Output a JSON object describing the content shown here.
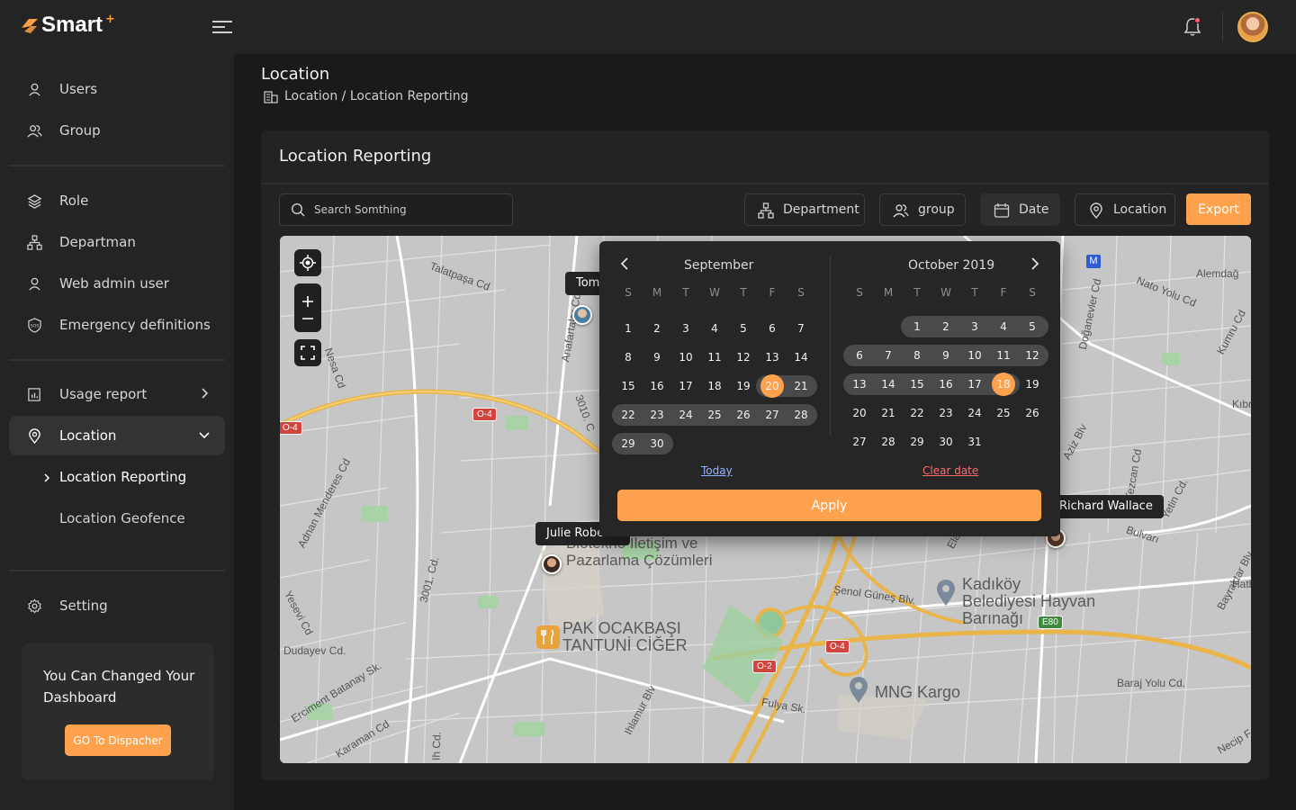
{
  "brand": {
    "name": "Smart",
    "sup": "+",
    "accent": "#ffa24d"
  },
  "sidebar": {
    "items": [
      {
        "label": "Users",
        "icon": "user-icon"
      },
      {
        "label": "Group",
        "icon": "users-icon"
      },
      {
        "label": "Role",
        "icon": "layers-icon"
      },
      {
        "label": "Departman",
        "icon": "org-chart-icon"
      },
      {
        "label": "Web admin user",
        "icon": "user-icon"
      },
      {
        "label": "Emergency definitions",
        "icon": "sos-shield-icon"
      },
      {
        "label": "Usage report",
        "icon": "report-icon"
      },
      {
        "label": "Location",
        "icon": "location-pin-icon"
      },
      {
        "label": "Setting",
        "icon": "gear-icon"
      }
    ],
    "location_sub": [
      {
        "label": "Location Reporting"
      },
      {
        "label": "Location Geofence"
      }
    ],
    "promo": {
      "text": "You Can Changed Your Dashboard",
      "button": "GO To Dispacher"
    }
  },
  "header": {
    "title": "Location",
    "breadcrumb": "Location / Location Reporting"
  },
  "card": {
    "title": "Location Reporting",
    "search_placeholder": "Search Somthing",
    "filters": {
      "department": "Department",
      "group": "group",
      "date": "Date",
      "location": "Location"
    },
    "export": "Export"
  },
  "map": {
    "users": [
      "Tom",
      "Julie Roberts",
      "Richard Wallace"
    ],
    "poi": [
      "Biotekno İletişim ve Pazarlama Çözümleri",
      "PAK OCAKBAŞI TANTUNİ CİĞER",
      "Kadıköy Belediyesi Hayvan Barınağı",
      "MNG Kargo"
    ],
    "streets": [
      "Talatpaşa Cd",
      "Anafartalar Cd",
      "Nato Yolu Cd",
      "Alemdağ",
      "Kumru Cd",
      "Doğanevler Cd",
      "Adnan Menderes Cd",
      "3001. Cd.",
      "Şenol Güneş Blv.",
      "Fulya Sk.",
      "Ihlamur Blv",
      "Erciment Batanay Sk.",
      "Karaman Cd",
      "Dudayev Cd.",
      "Yesevi Cd",
      "Baraj Yolu Cd.",
      "Bayraktar Blv.",
      "Necip F",
      "Aziz Blv",
      "Tezcan Cd",
      "Yetin Cd.",
      "Bulvarı",
      "3010. C",
      "Ela",
      "Kıbr",
      "Hatb",
      "Ih Cd.",
      "Nesa Cd"
    ],
    "roads": [
      "O-4",
      "O-4",
      "O-4",
      "O-2",
      "E80"
    ],
    "metro": "M"
  },
  "datepicker": {
    "months": [
      {
        "name": "September",
        "lead": 0,
        "days": 30
      },
      {
        "name": "October 2019",
        "lead": 2,
        "days": 31
      }
    ],
    "dow": [
      "S",
      "M",
      "T",
      "W",
      "T",
      "F",
      "S"
    ],
    "selected": {
      "sep": 20,
      "oct": 18
    },
    "today_label": "Today",
    "clear_label": "Clear date",
    "apply_label": "Apply"
  }
}
